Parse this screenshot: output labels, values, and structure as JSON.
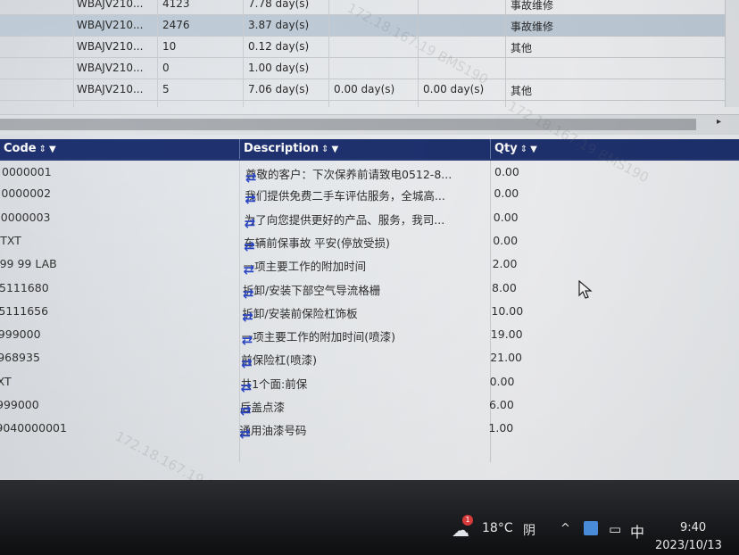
{
  "top_table": {
    "rows": [
      {
        "vin": "WBAJV210...",
        "km": "4123",
        "d1": "7.78 day(s)",
        "d2": "",
        "d3": "",
        "type": "事故维修",
        "selected": false
      },
      {
        "vin": "WBAJV210...",
        "km": "2476",
        "d1": "3.87 day(s)",
        "d2": "",
        "d3": "",
        "type": "事故维修",
        "selected": true
      },
      {
        "vin": "WBAJV210...",
        "km": "10",
        "d1": "0.12 day(s)",
        "d2": "",
        "d3": "",
        "type": "其他",
        "selected": false
      },
      {
        "vin": "WBAJV210...",
        "km": "0",
        "d1": "1.00 day(s)",
        "d2": "",
        "d3": "",
        "type": "",
        "selected": false
      },
      {
        "vin": "WBAJV210...",
        "km": "5",
        "d1": "7.06 day(s)",
        "d2": "0.00 day(s)",
        "d3": "0.00 day(s)",
        "type": "其他",
        "selected": false
      }
    ],
    "scroll_arrow": "▸"
  },
  "parts_table": {
    "headers": {
      "code": "Code",
      "description": "Description",
      "qty": "Qty",
      "sort_icon": "⇕",
      "filter_icon": "▼"
    },
    "rows": [
      {
        "code": "0000001",
        "description": "尊敬的客户：下次保养前请致电0512-8...",
        "qty": "0.00"
      },
      {
        "code": "0000002",
        "description": "我们提供免费二手车评估服务，全城高...",
        "qty": "0.00"
      },
      {
        "code": "0000003",
        "description": "为了向您提供更好的产品、服务，我司...",
        "qty": "0.00"
      },
      {
        "code": "TXT",
        "description": "车辆前保事故 平安(停放受损)",
        "qty": "0.00"
      },
      {
        "code": "99 99 LAB",
        "description": "一项主要工作的附加时间",
        "qty": "2.00"
      },
      {
        "code": "5111680",
        "description": "拆卸/安装下部空气导流格栅",
        "qty": "8.00"
      },
      {
        "code": "5111656",
        "description": "拆卸/安装前保险杠饰板",
        "qty": "10.00"
      },
      {
        "code": "999000",
        "description": "一项主要工作的附加时间(喷漆)",
        "qty": "19.00"
      },
      {
        "code": "968935",
        "description": "前保险杠(喷漆)",
        "qty": "21.00"
      },
      {
        "code": "XT",
        "description": "共1个面:前保",
        "qty": "0.00"
      },
      {
        "code": "999000",
        "description": "后盖点漆",
        "qty": "6.00"
      },
      {
        "code": "9040000001",
        "description": "通用油漆号码",
        "qty": "1.00"
      }
    ],
    "swap_icon": "⇄"
  },
  "watermark_text": "172.18.167.19 BMS190",
  "taskbar": {
    "weather_icon": "cloud-icon",
    "notification_count": "1",
    "temperature": "18°C",
    "condition": "阴",
    "tray_up": "^",
    "input_method": "中",
    "time": "9:40",
    "date": "2023/10/13"
  }
}
